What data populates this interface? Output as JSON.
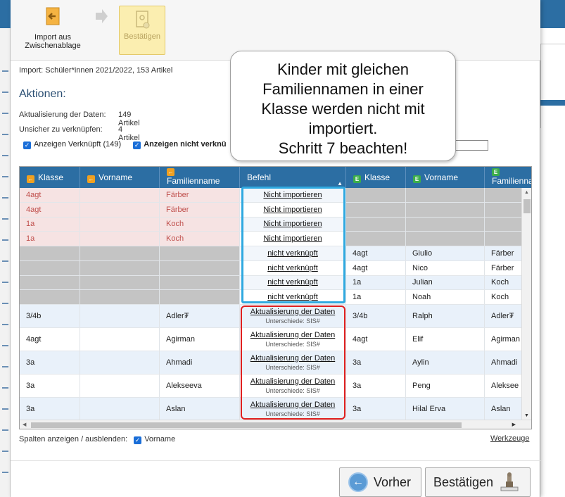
{
  "toolbar": {
    "import_label": "Import aus Zwischenablage",
    "confirm_label": "Bestätigen"
  },
  "info": {
    "import_text": "Import: Schüler*innen 2021/2022, 153 Artikel",
    "actions_title": "Aktionen:",
    "update_label": "Aktualisierung der Daten:",
    "update_value": "149 Artikel",
    "unsure_label": "Unsicher zu verknüpfen:",
    "unsure_value": "4 Artikel",
    "show_linked": "Anzeigen Verknüpft (149)",
    "show_unlinked": "Anzeigen nicht verknü"
  },
  "callout": {
    "line1": "Kinder mit gleichen",
    "line2": "Familiennamen in einer",
    "line3": "Klasse werden nicht mit",
    "line4": "importiert.",
    "line5": "Schritt 7 beachten!"
  },
  "table": {
    "headers": {
      "klasse": "Klasse",
      "vorname": "Vorname",
      "familienname": "Familienname",
      "befehl": "Befehl",
      "klasse2": "Klasse",
      "vorname2": "Vorname",
      "familienname2": "Familienna"
    },
    "rows": [
      {
        "klasse": "4agt",
        "vorname": "",
        "familienname": "Färber",
        "cmd": "Nicht importieren",
        "sub": "",
        "klasse2": "",
        "vorname2": "",
        "familienname2": ""
      },
      {
        "klasse": "4agt",
        "vorname": "",
        "familienname": "Färber",
        "cmd": "Nicht importieren",
        "sub": "",
        "klasse2": "",
        "vorname2": "",
        "familienname2": ""
      },
      {
        "klasse": "1a",
        "vorname": "",
        "familienname": "Koch",
        "cmd": "Nicht importieren",
        "sub": "",
        "klasse2": "",
        "vorname2": "",
        "familienname2": ""
      },
      {
        "klasse": "1a",
        "vorname": "",
        "familienname": "Koch",
        "cmd": "Nicht importieren",
        "sub": "",
        "klasse2": "",
        "vorname2": "",
        "familienname2": ""
      },
      {
        "klasse": "",
        "vorname": "",
        "familienname": "",
        "cmd": "nicht verknüpft",
        "sub": "",
        "klasse2": "4agt",
        "vorname2": "Giulio",
        "familienname2": "Färber"
      },
      {
        "klasse": "",
        "vorname": "",
        "familienname": "",
        "cmd": "nicht verknüpft",
        "sub": "",
        "klasse2": "4agt",
        "vorname2": "Nico",
        "familienname2": "Färber"
      },
      {
        "klasse": "",
        "vorname": "",
        "familienname": "",
        "cmd": "nicht verknüpft",
        "sub": "",
        "klasse2": "1a",
        "vorname2": "Julian",
        "familienname2": "Koch"
      },
      {
        "klasse": "",
        "vorname": "",
        "familienname": "",
        "cmd": "nicht verknüpft",
        "sub": "",
        "klasse2": "1a",
        "vorname2": "Noah",
        "familienname2": "Koch"
      },
      {
        "klasse": "3/4b",
        "vorname": "",
        "familienname": "Adler₮",
        "cmd": "Aktualisierung der Daten",
        "sub": "Unterschiede: SIS#",
        "klasse2": "3/4b",
        "vorname2": "Ralph",
        "familienname2": "Adler₮"
      },
      {
        "klasse": "4agt",
        "vorname": "",
        "familienname": "Agirman",
        "cmd": "Aktualisierung der Daten",
        "sub": "Unterschiede: SIS#",
        "klasse2": "4agt",
        "vorname2": "Elif",
        "familienname2": "Agirman"
      },
      {
        "klasse": "3a",
        "vorname": "",
        "familienname": "Ahmadi",
        "cmd": "Aktualisierung der Daten",
        "sub": "Unterschiede: SIS#",
        "klasse2": "3a",
        "vorname2": "Aylin",
        "familienname2": "Ahmadi"
      },
      {
        "klasse": "3a",
        "vorname": "",
        "familienname": "Alekseeva",
        "cmd": "Aktualisierung der Daten",
        "sub": "Unterschiede: SIS#",
        "klasse2": "3a",
        "vorname2": "Peng",
        "familienname2": "Aleksee"
      },
      {
        "klasse": "3a",
        "vorname": "",
        "familienname": "Aslan",
        "cmd": "Aktualisierung der Daten",
        "sub": "Unterschiede: SIS#",
        "klasse2": "3a",
        "vorname2": "Hilal Erva",
        "familienname2": "Aslan"
      }
    ]
  },
  "footer": {
    "columns_label": "Spalten anzeigen / ausblenden:",
    "columns_vorname": "Vorname",
    "tools_link": "Werkzeuge",
    "prev_button": "Vorher",
    "confirm_button": "Bestätigen"
  },
  "colors": {
    "header_blue": "#2c6ea3",
    "pink_row": "#f6e3e3",
    "pink_text": "#c0504d",
    "gray_row": "#c4c4c4",
    "blue_row": "#e9f1fa",
    "highlight_blue": "#2fa9e0",
    "highlight_red": "#e02020"
  }
}
